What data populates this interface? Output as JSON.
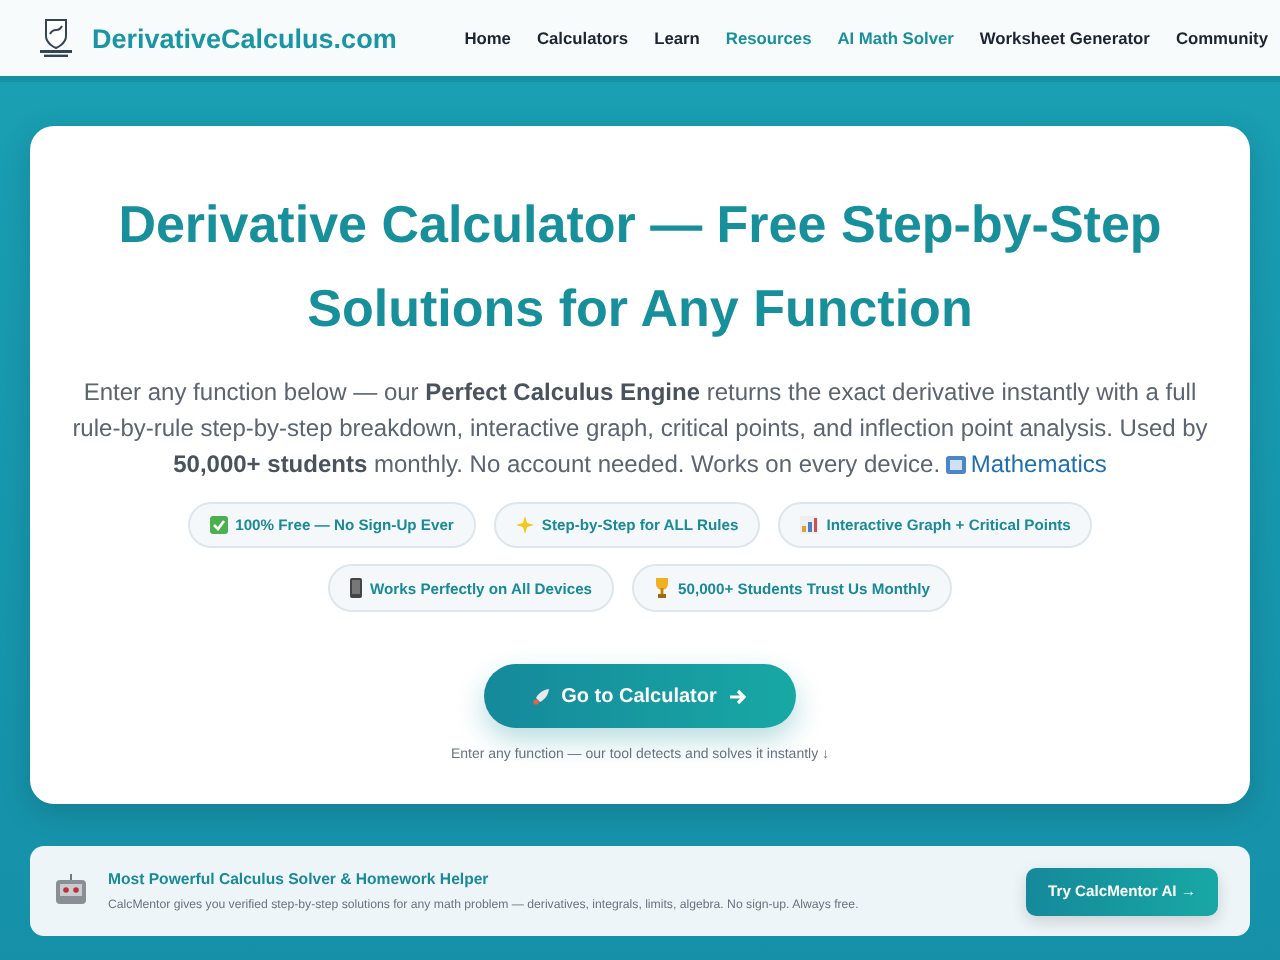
{
  "header": {
    "site_name": "DerivativeCalculus.com",
    "nav": [
      {
        "label": "Home",
        "highlighted": false
      },
      {
        "label": "Calculators",
        "highlighted": false
      },
      {
        "label": "Learn",
        "highlighted": false
      },
      {
        "label": "Resources",
        "highlighted": true
      },
      {
        "label": "AI Math Solver",
        "highlighted": true
      },
      {
        "label": "Worksheet Generator",
        "highlighted": false
      },
      {
        "label": "Community",
        "highlighted": false
      }
    ]
  },
  "hero": {
    "title": "Derivative Calculator — Free Step-by-Step Solutions for Any Function",
    "intro": "Enter any function below — our **Perfect Calculus Engine** returns the exact derivative instantly with a full rule-by-rule step-by-step breakdown, interactive graph, critical points, and inflection point analysis. Used by **50,000+ students** monthly. No account needed. Works on every device.",
    "category_link": "Mathematics",
    "badge_rows": [
      [
        {
          "kind": "check",
          "label": "100% Free — No Sign-Up Ever"
        },
        {
          "kind": "sparkle",
          "label": "Step-by-Step for ALL Rules"
        },
        {
          "kind": "chart",
          "label": "Interactive Graph + Critical Points"
        }
      ],
      [
        {
          "kind": "phone",
          "label": "Works Perfectly on All Devices"
        },
        {
          "kind": "trophy",
          "label": "50,000+ Students Trust Us Monthly"
        }
      ]
    ],
    "cta": "Go to Calculator",
    "hint": "Enter any function — our tool detects and solves it instantly ↓"
  },
  "promo": {
    "title": "Most Powerful Calculus Solver & Homework Helper",
    "text": "CalcMentor gives you verified step-by-step solutions for any math problem — derivatives, integrals, limits, algebra. No sign-up. Always free.",
    "button": "Try CalcMentor AI →"
  }
}
